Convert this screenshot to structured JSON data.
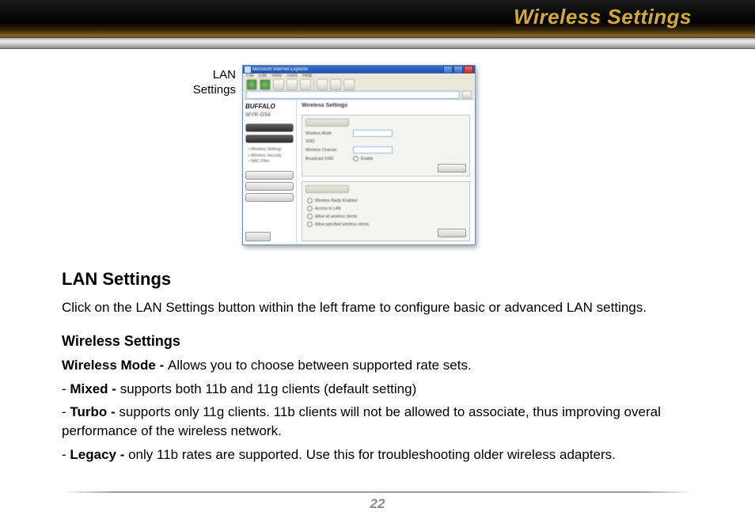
{
  "page": {
    "title": "Wireless Settings",
    "number": "22"
  },
  "callout": {
    "line1": "LAN",
    "line2": "Settings"
  },
  "screenshot": {
    "logo": "BUFFALO",
    "model": "WYR-G54",
    "right_heading": "Wireless Settings"
  },
  "body": {
    "h1": "LAN Settings",
    "p1": "Click on the LAN Settings button within the left frame to configure basic or advanced LAN settings.",
    "h2": "Wireless Settings",
    "wm_label": "Wireless Mode - ",
    "wm_text": "Allows you to choose between supported rate sets.",
    "mixed_label": "Mixed - ",
    "mixed_text": "supports both 11b and 11g clients (default setting)",
    "turbo_label": "Turbo - ",
    "turbo_text": "supports only 11g clients. 11b clients will not be allowed to associate, thus improving overal performance of the wireless network.",
    "legacy_label": "Legacy - ",
    "legacy_text": "only 11b rates are supported. Use this for troubleshooting older wireless adapters."
  }
}
